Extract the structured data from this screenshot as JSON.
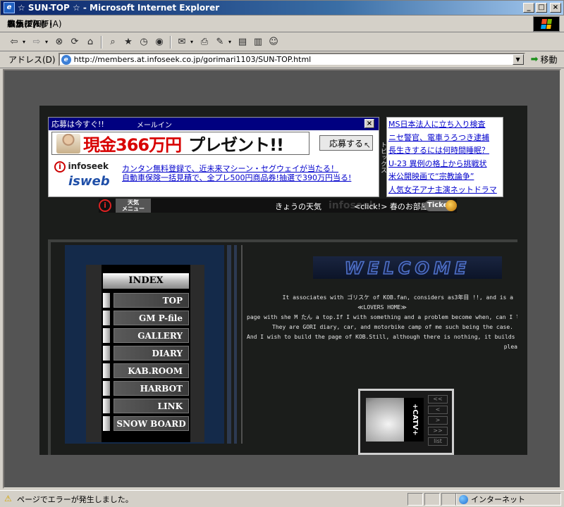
{
  "window": {
    "title": "☆ SUN-TOP ☆ - Microsoft Internet Explorer",
    "minimize": "_",
    "maximize": "□",
    "close": "×"
  },
  "menubar": {
    "items": [
      "ファイル(F)",
      "編集(E)",
      "表示(V)",
      "お気に入り(A)",
      "ツール(T)",
      "ヘルプ(H)"
    ]
  },
  "toolbar": {
    "icons": [
      "back-icon",
      "forward-icon",
      "stop-icon",
      "refresh-icon",
      "home-icon",
      "search-icon",
      "favorites-icon",
      "history-icon",
      "media-icon",
      "mail-icon",
      "print-icon",
      "edit-icon",
      "discuss-icon",
      "messenger-icon"
    ]
  },
  "addressbar": {
    "label": "アドレス(D)",
    "url": "http://members.at.infoseek.co.jp/gorimari1103/SUN-TOP.html",
    "go_label": "移動"
  },
  "ad": {
    "header": "応募は今すぐ!!",
    "mail_link": "メールイン",
    "close": "×",
    "prize": "現金366万円",
    "present": "プレゼント!!",
    "apply_button": "応募する",
    "logo_brand": "infoseek",
    "logo_sub": "isweb",
    "links": [
      "カンタン無料登録で、近未来マシーン・セグウェイが当たる！",
      "自動車保険一括見積で、全プレ500円商品券!抽選で390万円当る!"
    ]
  },
  "topics": {
    "tab_label": "トピックス",
    "items": [
      "MS日本法人に立ち入り検査",
      "ニセ警官、電車うろつき逮捕",
      "長生きするには何時間睡眠？",
      "U-23 異例の格上から挑戦状",
      "米公開映画で“宗教論争”",
      "人気女子アナ主演ネットドラマ"
    ]
  },
  "weather": {
    "menu_line1": "天気",
    "menu_line2": "メニュー",
    "today": "きょうの天気",
    "bg_logo": "infoseek",
    "click_text": "<click!> 春のお部屋",
    "ticker": "Ticker"
  },
  "menu": {
    "index": "INDEX",
    "items": [
      "TOP",
      "GM P-file",
      "GALLERY",
      "DIARY",
      "KAB.ROOM",
      "HARBOT",
      "LINK",
      "SNOW BOARD"
    ]
  },
  "welcome": {
    "title": "WELCOME",
    "lines": [
      "It associates with ゴリスケ of KOB.fan, considers as3年目 !!, and is a",
      "≪LOVERS HOME≫",
      "page with she M たん a top.If I with something and a problem become when, can I live by t",
      "They are GORI diary, car, and motorbike camp of me such being the case.",
      "And I wish to build the page of KOB.Still, although there is nothing, it builds endur",
      "plea"
    ]
  },
  "tv": {
    "logo": "+CATV+",
    "controls": [
      "<<",
      "<",
      ">",
      ">>",
      "list"
    ]
  },
  "status": {
    "text": "ページでエラーが発生しました。",
    "zone": "インターネット"
  },
  "colors": {
    "title_bar": "#0a246a",
    "site_bg": "#1b1d1b",
    "menu_panel": "#142a4a",
    "prize_red": "#d80000",
    "link_blue": "#0000cc"
  }
}
